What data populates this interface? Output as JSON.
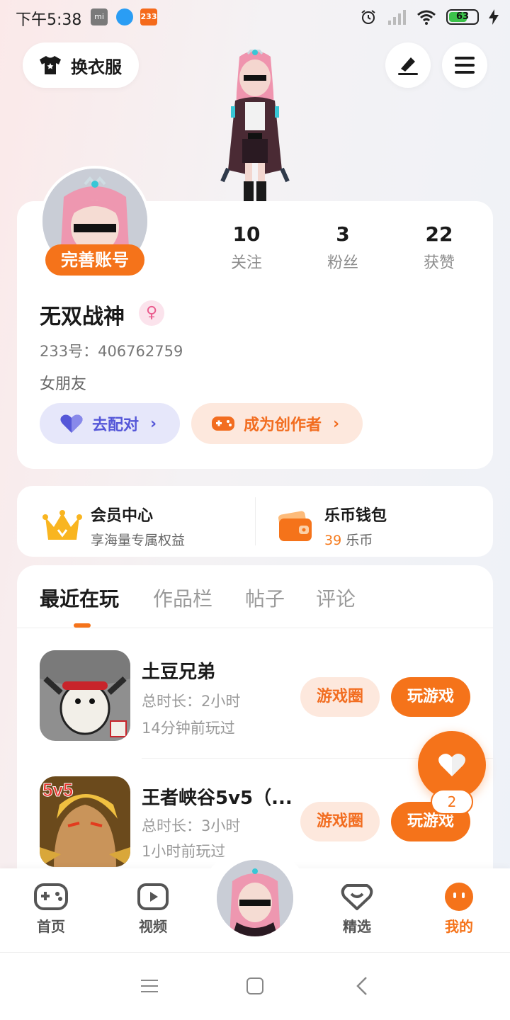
{
  "status_bar": {
    "time": "下午5:38",
    "app_badge_233": "233",
    "battery_level": "63"
  },
  "header": {
    "outfit_label": "换衣服"
  },
  "profile": {
    "complete_account": "完善账号",
    "stats": [
      {
        "value": "10",
        "label": "关注"
      },
      {
        "value": "3",
        "label": "粉丝"
      },
      {
        "value": "22",
        "label": "获赞"
      }
    ],
    "username": "无双战神",
    "gender_symbol": "♀",
    "id_text": "233号：406762759",
    "bio": "女朋友",
    "match_label": "去配对",
    "creator_label": "成为创作者"
  },
  "member": {
    "title": "会员中心",
    "subtitle": "享海量专属权益"
  },
  "wallet": {
    "title": "乐币钱包",
    "coins": "39",
    "unit": "乐币"
  },
  "tabs": [
    "最近在玩",
    "作品栏",
    "帖子",
    "评论"
  ],
  "games": [
    {
      "title": "土豆兄弟",
      "duration": "总时长：2小时",
      "last_played": "14分钟前玩过",
      "circle_label": "游戏圈",
      "play_label": "玩游戏"
    },
    {
      "title": "王者峡谷5v5（...",
      "duration": "总时长：3小时",
      "last_played": "1小时前玩过",
      "circle_label": "游戏圈",
      "play_label": "玩游戏",
      "thumb_text": "5v5"
    }
  ],
  "floating": {
    "count": "2"
  },
  "bottom_nav": [
    {
      "label": "首页"
    },
    {
      "label": "视频"
    },
    {
      "label": "精选"
    },
    {
      "label": "我的"
    }
  ],
  "colors": {
    "accent": "#f5731a",
    "match": "#5557d8"
  }
}
